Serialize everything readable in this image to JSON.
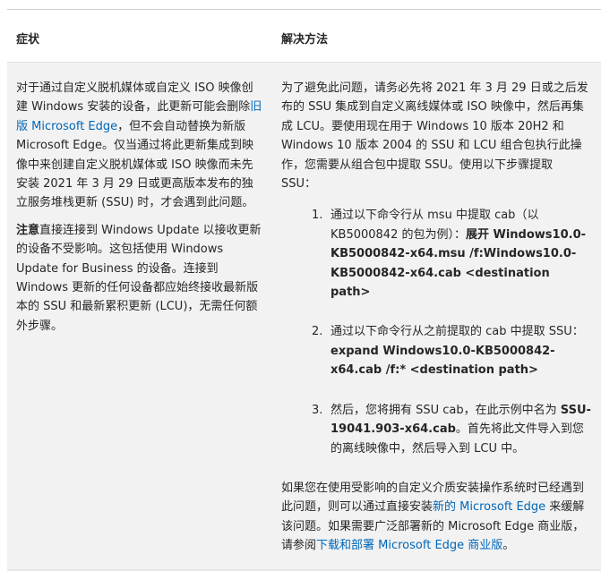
{
  "table": {
    "headers": {
      "symptom": "症状",
      "workaround": "解决方法"
    },
    "symptom": {
      "p1": {
        "before_link": "对于通过自定义脱机媒体或自定义 ISO 映像创建 Windows 安装的设备，此更新可能会删除",
        "link": "旧版 Microsoft Edge",
        "after_link": "，但不会自动替换为新版 Microsoft Edge。仅当通过将此更新集成到映像中来创建自定义脱机媒体或 ISO 映像而未先安装 2021 年 3 月 29 日或更高版本发布的独立服务堆栈更新 (SSU) 时，才会遇到此问题。"
      },
      "p2": {
        "bold": "注意",
        "text": "直接连接到 Windows Update 以接收更新的设备不受影响。这包括使用 Windows Update for Business 的设备。连接到 Windows 更新的任何设备都应始终接收最新版本的 SSU 和最新累积更新 (LCU)，无需任何额外步骤。"
      }
    },
    "workaround": {
      "intro": "为了避免此问题，请务必先将 2021 年 3 月 29 日或之后发布的 SSU 集成到自定义离线媒体或 ISO 映像中，然后再集成 LCU。要使用现在用于 Windows 10 版本 20H2 和 Windows 10 版本 2004 的 SSU 和 LCU 组合包执行此操作，您需要从组合包中提取 SSU。使用以下步骤提取 SSU：",
      "steps": [
        {
          "num": "1.",
          "text": "通过以下命令行从 msu 中提取 cab（以 KB5000842 的包为例）：",
          "bold": "展开 Windows10.0-KB5000842-x64.msu /f:Windows10.0-KB5000842-x64.cab <destination path>"
        },
        {
          "num": "2.",
          "text": "通过以下命令行从之前提取的 cab 中提取 SSU：",
          "bold": "expand Windows10.0-KB5000842-x64.cab /f:* <destination path>"
        },
        {
          "num": "3.",
          "text_before": "然后，您将拥有 SSU cab，在此示例中名为 ",
          "bold": "SSU-19041.903-x64.cab",
          "text_after": "。首先将此文件导入到您的离线映像中，然后导入到 LCU 中。"
        }
      ],
      "closing": {
        "before_link1": "如果您在使用受影响的自定义介质安装操作系统时已经遇到此问题，则可以通过直接安装",
        "link1": "新的 Microsoft Edge",
        "middle": " 来缓解该问题。如果需要广泛部署新的 Microsoft Edge 商业版，请参阅",
        "link2": "下载和部署 Microsoft Edge 商业版",
        "end": "。"
      }
    }
  }
}
